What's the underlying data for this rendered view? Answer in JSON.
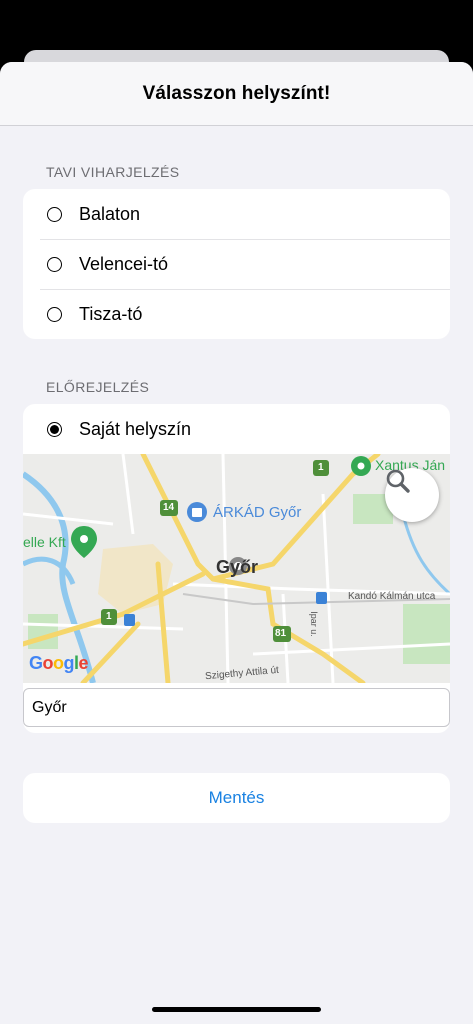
{
  "sheet": {
    "title": "Válasszon helyszínt!"
  },
  "storm_section": {
    "label": "TAVI VIHARJELZÉS",
    "options": [
      {
        "label": "Balaton",
        "selected": false
      },
      {
        "label": "Velencei-tó",
        "selected": false
      },
      {
        "label": "Tisza-tó",
        "selected": false
      }
    ]
  },
  "forecast_section": {
    "label": "ELŐREJELZÉS",
    "option": {
      "label": "Saját helyszín",
      "selected": true
    },
    "map": {
      "labels": {
        "place": "ÁRKÁD Győr",
        "city": "Győr",
        "street1": "Kandó Kálmán utca",
        "street2": "Szigethy Attila út",
        "street3": "Ipar u.",
        "business": "elle Kft",
        "zoo": "Xantus Ján",
        "route_14": "14",
        "route_1a": "1",
        "route_1b": "1",
        "route_81": "81"
      },
      "provider": "Google",
      "search_icon": "search-icon"
    },
    "location_value": "Győr",
    "location_placeholder": ""
  },
  "save_label": "Mentés",
  "colors": {
    "accent": "#1a82e2",
    "road_major": "#f5d66b",
    "water": "#8fc8ee",
    "park": "#c8e6c0"
  }
}
